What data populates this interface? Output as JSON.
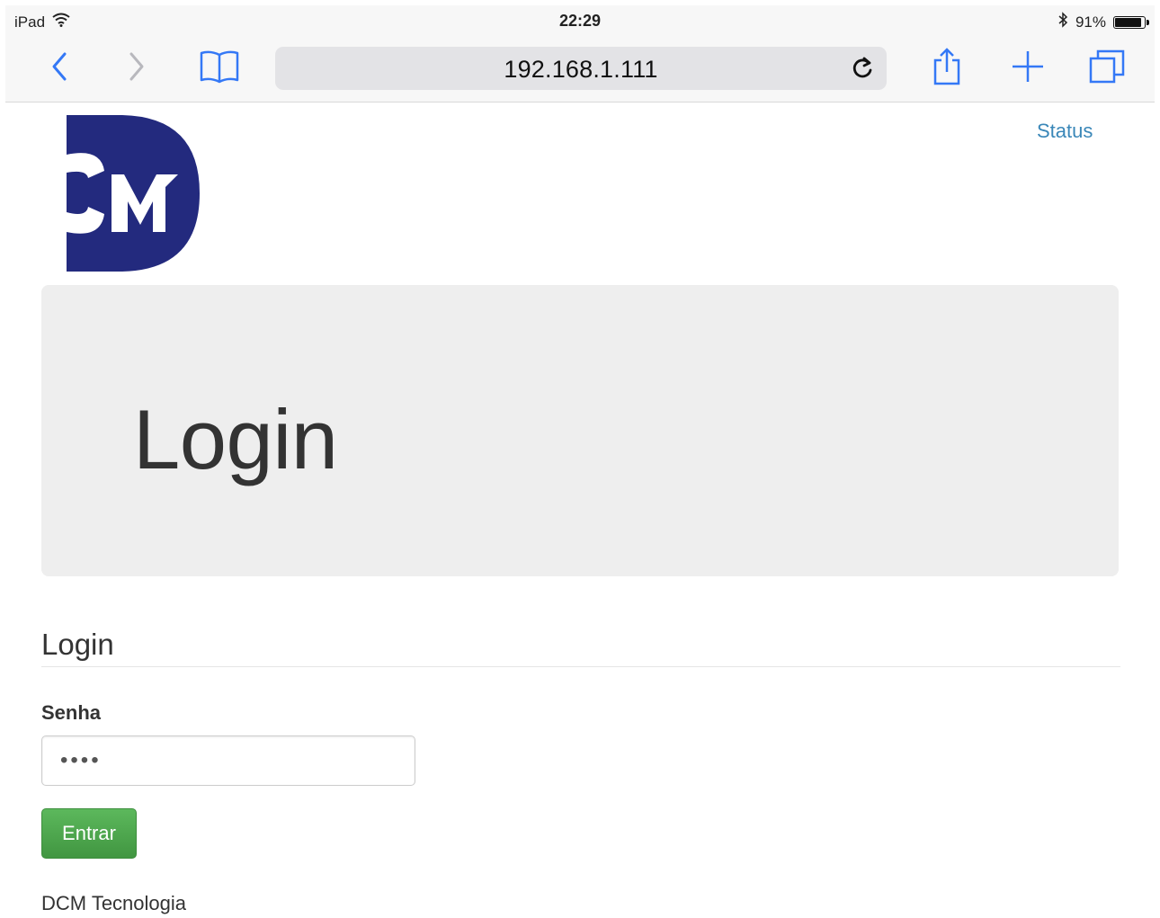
{
  "device": {
    "name": "iPad",
    "time": "22:29",
    "battery": "91%",
    "battery_level": 0.91
  },
  "browser": {
    "url": "192.168.1.111",
    "icons": [
      "back-icon",
      "forward-icon",
      "bookmarks-icon",
      "reload-icon",
      "share-icon",
      "new-tab-icon",
      "tabs-icon"
    ]
  },
  "nav": {
    "status_link": "Status"
  },
  "jumbotron": {
    "title": "Login"
  },
  "form": {
    "section_title": "Login",
    "password_label": "Senha",
    "password_value": "••••",
    "submit_label": "Entrar"
  },
  "footer": {
    "text": "DCM Tecnologia"
  },
  "colors": {
    "brand": "#232a7e",
    "link": "#3a87b8",
    "accent_ios": "#3478f6",
    "button": "#4bae4f",
    "jumbotron_bg": "#eeeeee"
  }
}
